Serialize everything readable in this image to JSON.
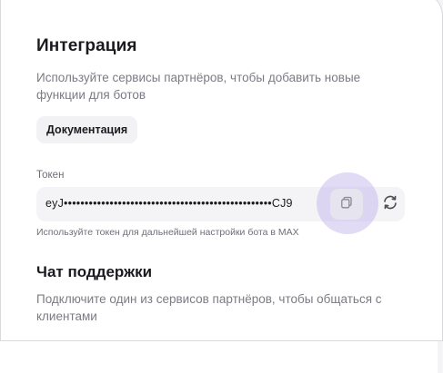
{
  "integration": {
    "title": "Интеграция",
    "subtitle": "Используйте сервисы партнёров, чтобы добавить новые функции для ботов",
    "documentation_button": "Документация"
  },
  "token": {
    "label": "Токен",
    "value": "eyJ••••••••••••••••••••••••••••••••••••••••••••••••••CJ9",
    "hint": "Используйте токен для дальнейшей настройки бота в MAX",
    "copy_icon": "copy-icon",
    "refresh_icon": "refresh-icon"
  },
  "support": {
    "title": "Чат поддержки",
    "subtitle": "Подключите один из сервисов партнёров, чтобы общаться с клиентами"
  },
  "colors": {
    "highlight": "#beafeb",
    "field_bg": "#f4f4f6",
    "text_primary": "#1a1a1f",
    "text_secondary": "#7b7b85"
  }
}
